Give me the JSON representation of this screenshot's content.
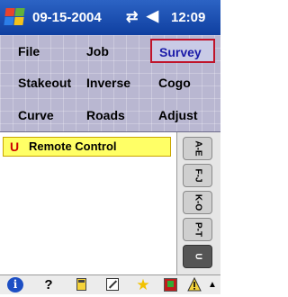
{
  "status_bar": {
    "date": "09-15-2004",
    "time": "12:09",
    "start_icon": "windows-start-icon",
    "connectivity_icon": "connectivity-icon",
    "volume_icon": "speaker-icon"
  },
  "menu": {
    "row1": [
      "File",
      "Job",
      "Survey"
    ],
    "row2": [
      "Stakeout",
      "Inverse",
      "Cogo"
    ],
    "row3": [
      "Curve",
      "Roads",
      "Adjust"
    ],
    "selected": "Survey"
  },
  "list": {
    "items": [
      {
        "icon_letter": "U",
        "label": "Remote Control"
      }
    ]
  },
  "index_tabs": [
    "A-E",
    "F-J",
    "K-O",
    "P-T",
    "U"
  ],
  "selected_tab": "U",
  "toolbar": {
    "icons": [
      "info-icon",
      "help-icon",
      "calculator-icon",
      "pen-icon",
      "star-icon",
      "record-icon",
      "warning-icon",
      "scroll-up-icon"
    ],
    "help_glyph": "?",
    "info_glyph": "i"
  },
  "colors": {
    "titlebar": "#1f55b8",
    "menu_bg": "#b9b7d1",
    "selected_border": "#c0142a",
    "item_highlight": "#ffff66"
  }
}
